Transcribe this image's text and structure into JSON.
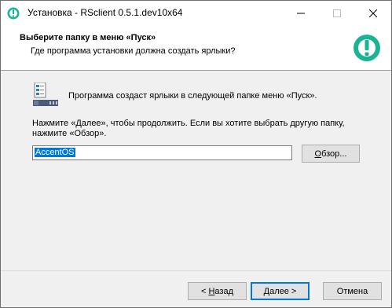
{
  "window": {
    "title": "Установка - RSclient 0.5.1.dev10x64",
    "controls": {
      "minimize": "—",
      "maximize": "☐",
      "close": "✕"
    }
  },
  "header": {
    "title": "Выберите папку в меню «Пуск»",
    "subtitle": "Где программа установки должна создать ярлыки?",
    "icon": "app-logo-icon"
  },
  "content": {
    "info": "Программа создаст ярлыки в следующей папке меню «Пуск».",
    "instruction_line1": "Нажмите «Далее», чтобы продолжить. Если вы хотите выбрать другую папку,",
    "instruction_line2": "нажмите «Обзор».",
    "folder_value": "AccentOS",
    "browse_label_ul": "О",
    "browse_label_rest": "бзор..."
  },
  "footer": {
    "back_prefix": "< ",
    "back_ul": "Н",
    "back_rest": "азад",
    "next_ul": "Д",
    "next_rest": "алее >",
    "cancel_label": "Отмена"
  },
  "colors": {
    "accent": "#0078d7",
    "logo": "#1ab394"
  }
}
